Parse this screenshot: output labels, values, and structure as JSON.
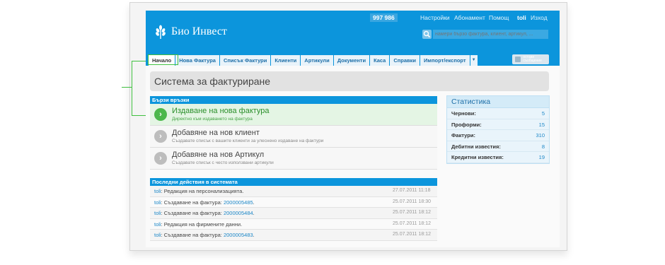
{
  "brand": {
    "name": "Био Инвест"
  },
  "topbar": {
    "counter": "997 986",
    "links": [
      "Настройки",
      "Абонамент",
      "Помощ"
    ],
    "user": "toli",
    "logout": "Изход"
  },
  "search": {
    "placeholder": "намери бързо фактура, клиент, артикул, ..."
  },
  "nav": {
    "items": [
      "Начало",
      "Нова Фактура",
      "Списък Фактури",
      "Клиенти",
      "Артикули",
      "Документи",
      "Каса",
      "Справки",
      "Импорт/експорт"
    ],
    "more": "▼",
    "message_label": "остави съобщение"
  },
  "page_title": "Система за фактуриране",
  "quick_links": {
    "heading": "Бързи връзки",
    "items": [
      {
        "title": "Издаване на нова фактура",
        "subtitle": "Директно към издаването на фактура"
      },
      {
        "title": "Добавяне на нов клиент",
        "subtitle": "Създавате списък с вашите клиенти за улеснено издаване на фактури"
      },
      {
        "title": "Добавяне на нов Артикул",
        "subtitle": "Създавате списък с често използвани артикули"
      }
    ]
  },
  "recent": {
    "heading": "Последни действия в системата",
    "rows": [
      {
        "user": "toli",
        "text": ": Редакция на персонализацията.",
        "link": "",
        "date": "27.07.2011 11:18"
      },
      {
        "user": "toli",
        "text": ": Създаване на фактура: ",
        "link": "2000005485",
        "date": "25.07.2011 18:30"
      },
      {
        "user": "toli",
        "text": ": Създаване на фактура: ",
        "link": "2000005484",
        "date": "25.07.2011 18:12"
      },
      {
        "user": "toli",
        "text": ": Редакция на фирмените данни.",
        "link": "",
        "date": "25.07.2011 18:12"
      },
      {
        "user": "toli",
        "text": ": Създаване на фактура: ",
        "link": "2000005483",
        "date": "25.07.2011 18:12"
      }
    ]
  },
  "stats": {
    "title": "Статистика",
    "rows": [
      {
        "label": "Чернови:",
        "value": "5"
      },
      {
        "label": "Проформи:",
        "value": "15"
      },
      {
        "label": "Фактури:",
        "value": "310"
      },
      {
        "label": "Дебитни известия:",
        "value": "8"
      },
      {
        "label": "Кредитни известия:",
        "value": "19"
      }
    ]
  },
  "colors": {
    "header": "#0c95dc",
    "accent_green": "#4cb84c",
    "link": "#1e88c8"
  }
}
